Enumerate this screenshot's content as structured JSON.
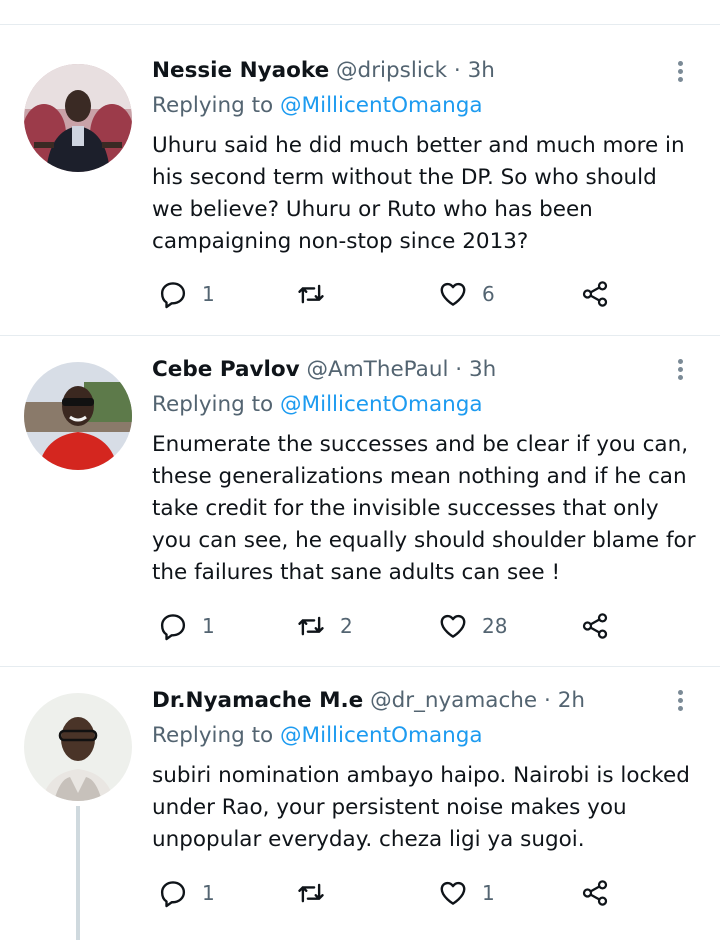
{
  "tweets": [
    {
      "name": "Nessie Nyaoke",
      "handle": "@dripslick",
      "separator": "·",
      "time": "3h",
      "replying_prefix": "Replying to ",
      "replying_to": "@MillicentOmanga",
      "text": "Uhuru said he did much better and much more in\nhis second term without the DP. So who should\nwe believe? Uhuru or Ruto who has been\ncampaigning non-stop since 2013?",
      "replies": "1",
      "retweets": "",
      "likes": "6"
    },
    {
      "name": "Cebe Pavlov",
      "handle": "@AmThePaul",
      "separator": "·",
      "time": "3h",
      "replying_prefix": "Replying to ",
      "replying_to": "@MillicentOmanga",
      "text": "Enumerate the successes and be clear if you can,\nthese  generalizations mean nothing and if he can\ntake credit for the invisible successes that only\nyou can see, he equally should shoulder blame for\nthe failures that sane  adults can see !",
      "replies": "1",
      "retweets": "2",
      "likes": "28"
    },
    {
      "name": "Dr.Nyamache M.e",
      "handle": "@dr_nyamache",
      "separator": "·",
      "time": "2h",
      "replying_prefix": "Replying to ",
      "replying_to": "@MillicentOmanga",
      "text": "subiri nomination ambayo haipo. Nairobi is locked\nunder Rao, your persistent noise makes you\nunpopular everyday. cheza ligi  ya sugoi.",
      "replies": "1",
      "retweets": "",
      "likes": "1"
    }
  ],
  "icons": {
    "reply": "reply-icon",
    "retweet": "retweet-icon",
    "like": "heart-icon",
    "share": "share-icon",
    "more": "more-options-icon"
  },
  "colors": {
    "mention": "#1d9bf0",
    "secondary_text": "#536471",
    "primary_text": "#0f1419",
    "divider": "#e6ecf0",
    "thread_line": "#cfd9de"
  }
}
